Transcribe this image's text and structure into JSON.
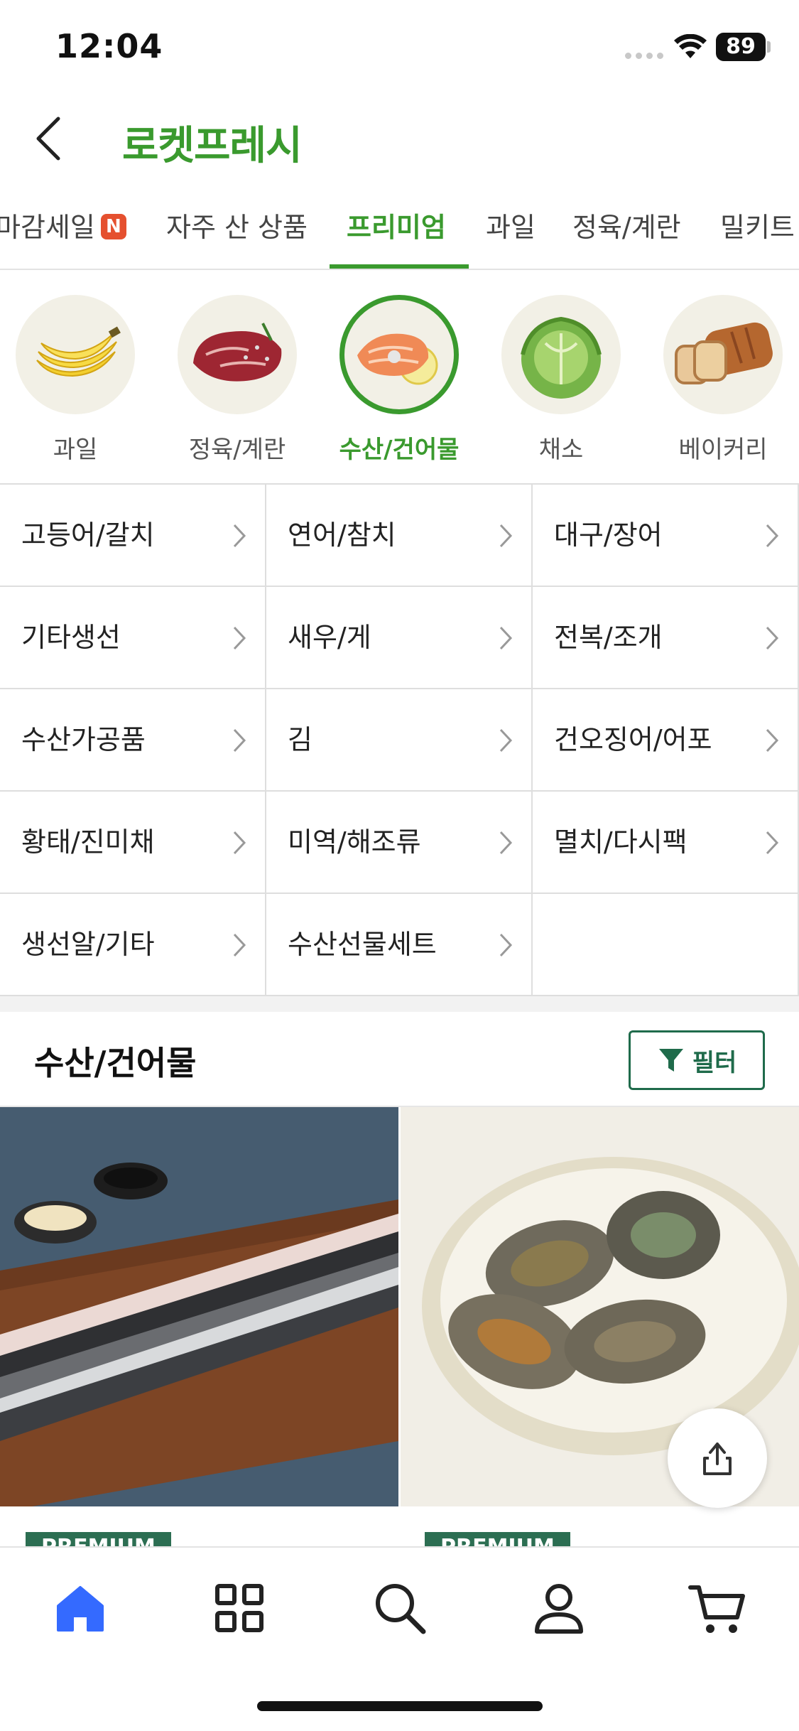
{
  "status_bar": {
    "time": "12:04",
    "battery": "89"
  },
  "header": {
    "title": "로켓프레시"
  },
  "top_tabs": [
    {
      "label": "마감세일",
      "badge": "N"
    },
    {
      "label": "자주 산 상품"
    },
    {
      "label": "프리미엄",
      "active": true
    },
    {
      "label": "과일"
    },
    {
      "label": "정육/계란"
    },
    {
      "label": "밀키트"
    }
  ],
  "categories": [
    {
      "label": "과일",
      "icon": "banana-icon"
    },
    {
      "label": "정육/계란",
      "icon": "beef-icon"
    },
    {
      "label": "수산/건어물",
      "icon": "salmon-icon",
      "active": true
    },
    {
      "label": "채소",
      "icon": "cabbage-icon"
    },
    {
      "label": "베이커리",
      "icon": "bread-icon"
    }
  ],
  "subcategories": [
    [
      "고등어/갈치",
      "연어/참치",
      "대구/장어"
    ],
    [
      "기타생선",
      "새우/게",
      "전복/조개"
    ],
    [
      "수산가공품",
      "김",
      "건오징어/어포"
    ],
    [
      "황태/진미채",
      "미역/해조류",
      "멸치/다시팩"
    ],
    [
      "생선알/기타",
      "수산선물세트",
      ""
    ]
  ],
  "section": {
    "title": "수산/건어물",
    "filter_label": "필터"
  },
  "products": [
    {
      "badge": "PREMIUM",
      "image": "eel-fillets-on-board"
    },
    {
      "badge": "PREMIUM",
      "image": "abalone-plate"
    }
  ],
  "bottom_nav": [
    {
      "name": "home-icon",
      "active": true
    },
    {
      "name": "category-grid-icon"
    },
    {
      "name": "search-icon"
    },
    {
      "name": "profile-icon"
    },
    {
      "name": "cart-icon"
    }
  ],
  "colors": {
    "accent": "#3a9a2e",
    "premium": "#2c6e52",
    "badge_new": "#e5502f",
    "nav_active": "#346aff"
  }
}
